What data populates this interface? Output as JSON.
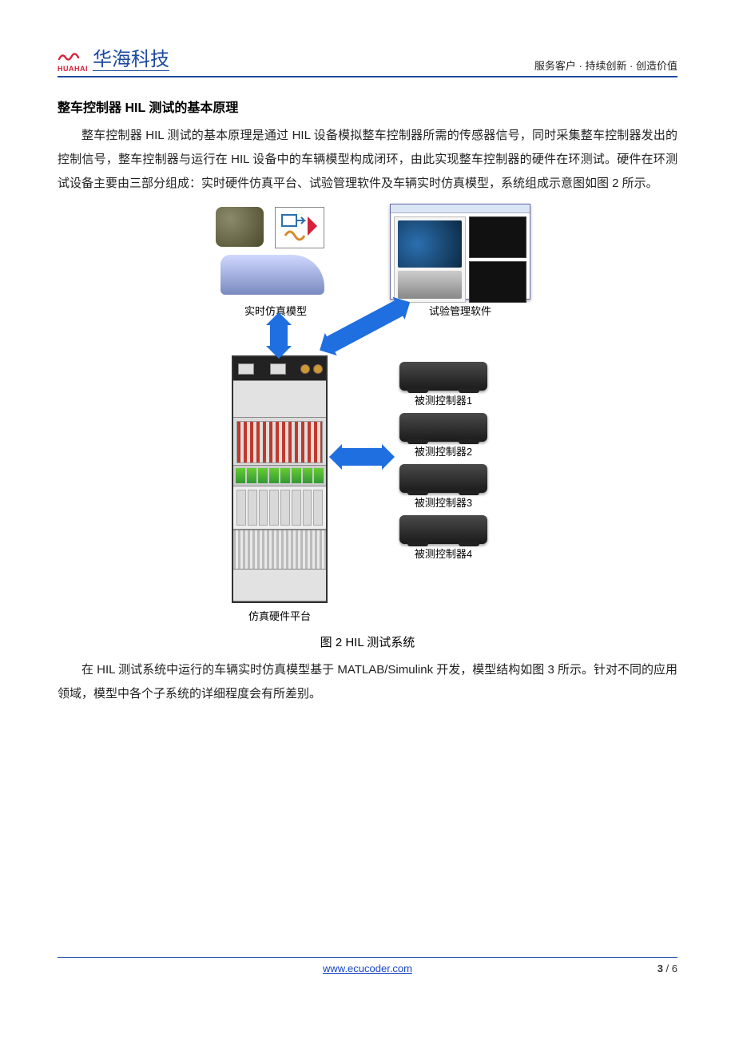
{
  "header": {
    "logo_pinyin": "HUAHAI",
    "logo_text": "华海科技",
    "tagline": "服务客户 · 持续创新 · 创造价值"
  },
  "section": {
    "title": "整车控制器 HIL 测试的基本原理",
    "paragraph": "整车控制器 HIL 测试的基本原理是通过 HIL 设备模拟整车控制器所需的传感器信号，同时采集整车控制器发出的控制信号，整车控制器与运行在 HIL 设备中的车辆模型构成闭环，由此实现整车控制器的硬件在环测试。硬件在环测试设备主要由三部分组成：实时硬件仿真平台、试验管理软件及车辆实时仿真模型，系统组成示意图如图 2 所示。"
  },
  "figure": {
    "caption": "图 2 HIL 测试系统",
    "labels": {
      "sim_model": "实时仿真模型",
      "mgmt_software": "试验管理软件",
      "ecu1": "被测控制器1",
      "ecu2": "被测控制器2",
      "ecu3": "被测控制器3",
      "ecu4": "被测控制器4",
      "hw_platform": "仿真硬件平台"
    }
  },
  "section2": {
    "paragraph": "在 HIL 测试系统中运行的车辆实时仿真模型基于 MATLAB/Simulink 开发，模型结构如图 3 所示。针对不同的应用领域，模型中各个子系统的详细程度会有所差别。"
  },
  "footer": {
    "url": "www.ecucoder.com",
    "page_current": "3",
    "page_sep": " / ",
    "page_total": "6"
  }
}
